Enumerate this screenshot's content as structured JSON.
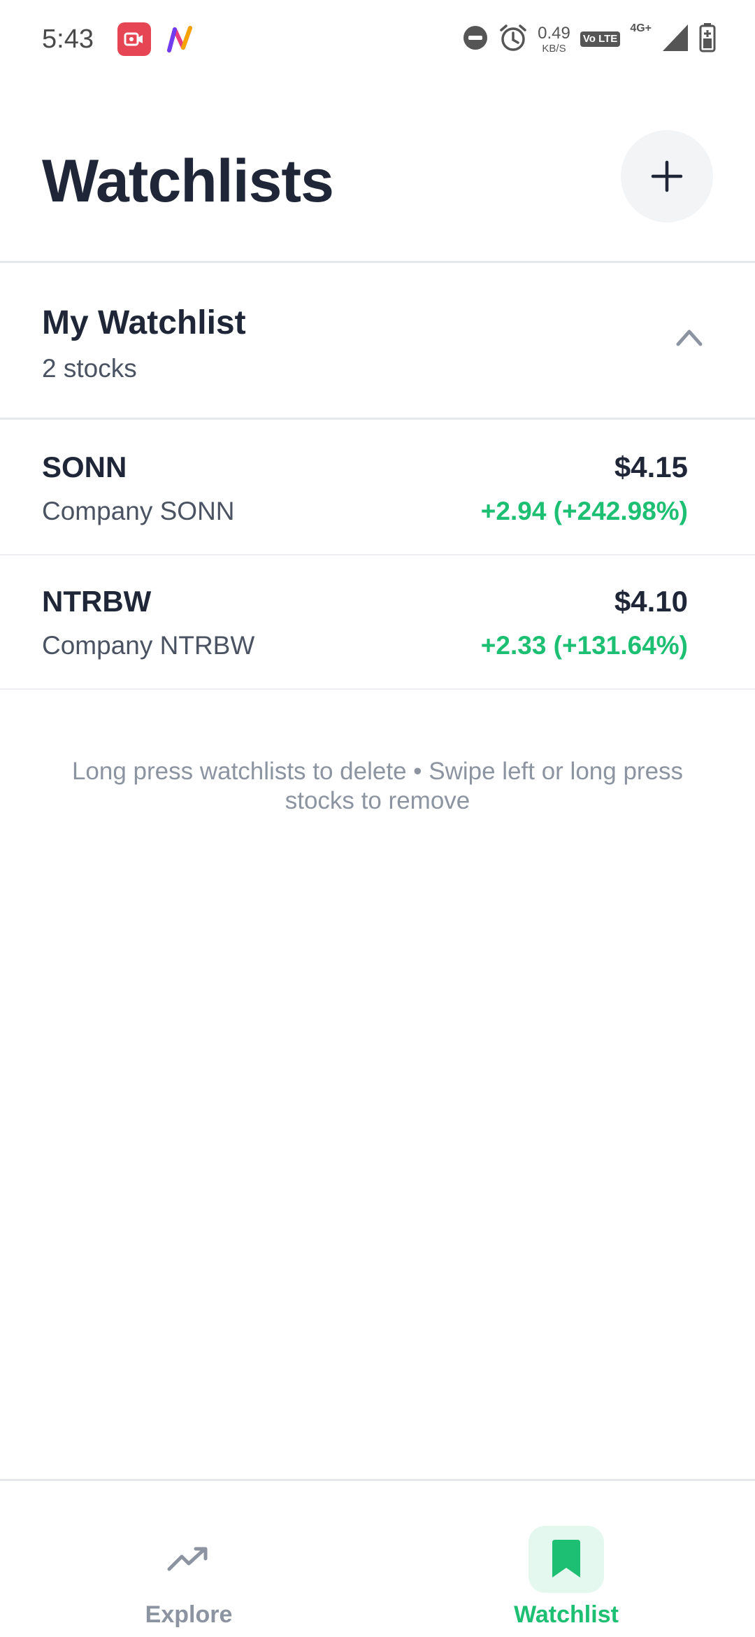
{
  "status_bar": {
    "time": "5:43",
    "net_speed_value": "0.49",
    "net_speed_unit": "KB/S",
    "volte_label": "Vo LTE",
    "network_type": "4G+",
    "icons": [
      "screen-recorder-icon",
      "app-n-icon",
      "do-not-disturb-icon",
      "alarm-icon",
      "volte-icon",
      "signal-icon",
      "battery-icon"
    ]
  },
  "header": {
    "title": "Watchlists",
    "add_button_icon": "plus-icon"
  },
  "watchlist": {
    "name": "My Watchlist",
    "count_label": "2 stocks",
    "expanded": true,
    "stocks": [
      {
        "symbol": "SONN",
        "company": "Company SONN",
        "price": "$4.15",
        "change": "+2.94 (+242.98%)"
      },
      {
        "symbol": "NTRBW",
        "company": "Company NTRBW",
        "price": "$4.10",
        "change": "+2.33 (+131.64%)"
      }
    ]
  },
  "hint_text": "Long press watchlists to delete • Swipe left or long press stocks to remove",
  "bottom_nav": {
    "items": [
      {
        "label": "Explore",
        "icon": "trending-up-icon",
        "active": false
      },
      {
        "label": "Watchlist",
        "icon": "bookmark-icon",
        "active": true
      }
    ]
  },
  "colors": {
    "accent": "#1dbf73",
    "text_primary": "#1e2637",
    "text_secondary": "#4b5363",
    "muted": "#8c93a1",
    "active_nav_bg": "#e4f8ef"
  }
}
